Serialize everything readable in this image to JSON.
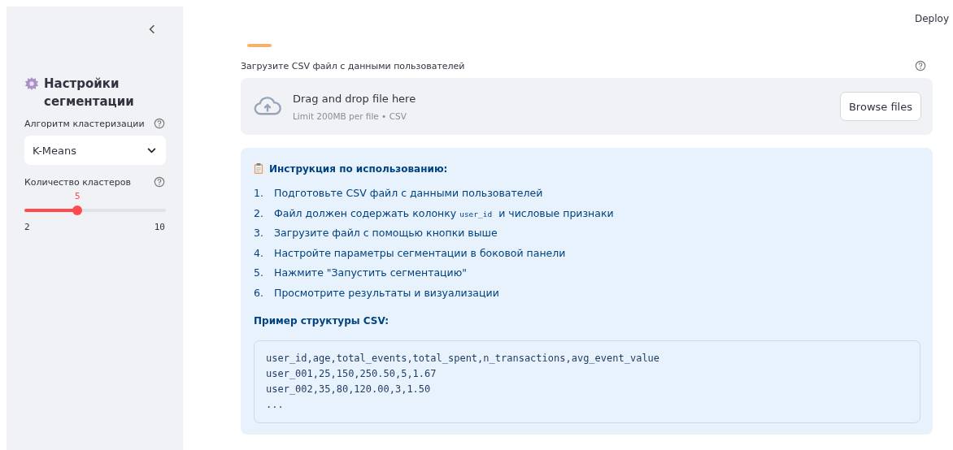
{
  "sidebar": {
    "title": "Настройки сегментации",
    "algorithm": {
      "label": "Алгоритм кластеризации",
      "value": "K-Means"
    },
    "clusters": {
      "label": "Количество кластеров",
      "value": "5",
      "level": 0.375,
      "min": "2",
      "max": "10"
    }
  },
  "header": {
    "deploy": "Deploy"
  },
  "uploader": {
    "label": "Загрузите CSV файл с данными пользователей",
    "drop_text": "Drag and drop file here",
    "limit": "Limit 200MB per file • CSV",
    "button": "Browse files"
  },
  "instructions": {
    "title": "Инструкция по использованию:",
    "steps": [
      {
        "number": "1.",
        "text": "Подготовьте CSV файл с данными пользователей"
      },
      {
        "number": "2.",
        "text": "Файл должен содержать колонку",
        "code": "user_id",
        "text_after": "и числовые признаки"
      },
      {
        "number": "3.",
        "text": "Загрузите файл с помощью кнопки выше"
      },
      {
        "number": "4.",
        "text": "Настройте параметры сегментации в боковой панели"
      },
      {
        "number": "5.",
        "text": "Нажмите \"Запустить сегментацию\""
      },
      {
        "number": "6.",
        "text": "Просмотрите результаты и визуализации"
      }
    ],
    "example_title": "Пример структуры CSV:",
    "example_lines": [
      "user_id,age,total_events,total_spent,n_transactions,avg_event_value",
      "user_001,25,150,250.50,5,1.67",
      "user_002,35,80,120.00,3,1.50",
      "..."
    ]
  }
}
